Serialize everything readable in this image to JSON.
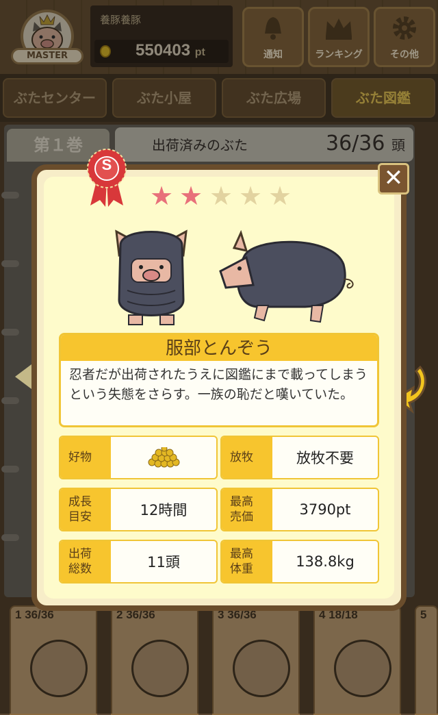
{
  "header": {
    "badge_label": "MASTER",
    "user_name": "養豚養豚",
    "points": "550403",
    "points_unit": "pt",
    "buttons": [
      {
        "label": "通知",
        "icon": "bell-icon"
      },
      {
        "label": "ランキング",
        "icon": "crown-icon"
      },
      {
        "label": "その他",
        "icon": "gear-icon"
      }
    ]
  },
  "tabs": [
    {
      "label": "ぶたセンター",
      "active": false
    },
    {
      "label": "ぶた小屋",
      "active": false
    },
    {
      "label": "ぶた広場",
      "active": false
    },
    {
      "label": "ぶた図鑑",
      "active": true
    }
  ],
  "book": {
    "volume_label": "第１巻",
    "shipped_label": "出荷済みのぶた",
    "shipped_count": "36/36",
    "shipped_unit": "頭"
  },
  "volumes": [
    {
      "number": "1",
      "count": "36/36"
    },
    {
      "number": "2",
      "count": "36/36"
    },
    {
      "number": "3",
      "count": "36/36"
    },
    {
      "number": "4",
      "count": "18/18"
    },
    {
      "number": "5",
      "count": ""
    }
  ],
  "detail": {
    "rank_badge": "S",
    "stars_filled": 2,
    "stars_total": 5,
    "name": "服部とんぞう",
    "description": "忍者だが出荷されたうえに図鑑にまで載ってしまうという失態をさらす。一族の恥だと嘆いていた。",
    "stats": {
      "favorite": {
        "label": "好物",
        "value_icon": "grain-pile-icon"
      },
      "grazing": {
        "label": "放牧",
        "value": "放牧不要"
      },
      "growth": {
        "label": "成長\n目安",
        "value": "12時間"
      },
      "max_price": {
        "label": "最高\n売価",
        "value": "3790pt"
      },
      "shipped": {
        "label": "出荷\n総数",
        "value": "11頭"
      },
      "max_weight": {
        "label": "最高\n体重",
        "value": "138.8kg"
      }
    }
  },
  "colors": {
    "accent": "#f7c52e",
    "star_filled": "#e8707a",
    "star_empty": "#e2d3a0",
    "modal_border": "#6a4d2c"
  }
}
